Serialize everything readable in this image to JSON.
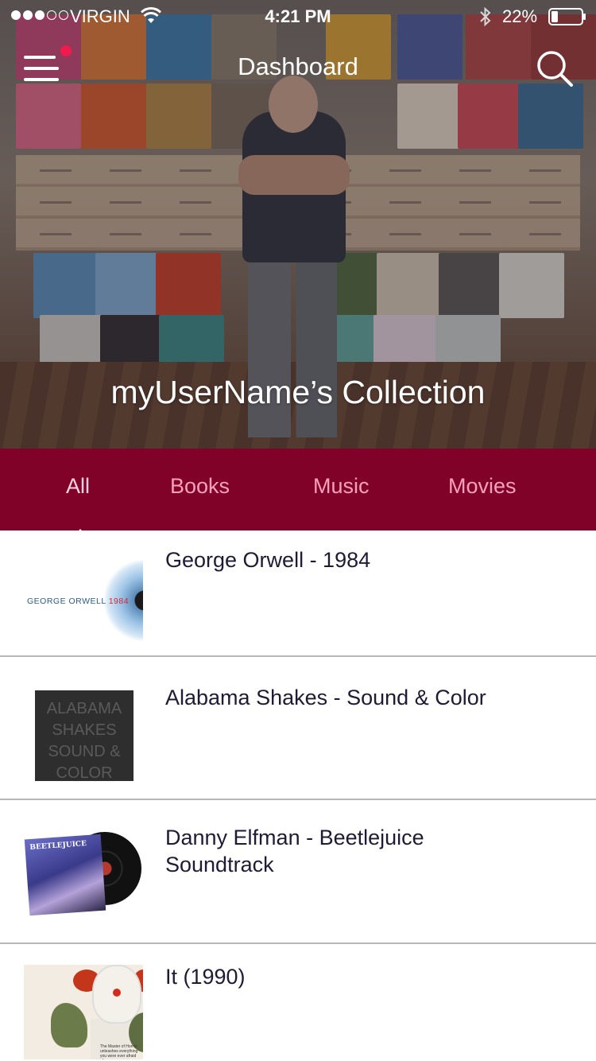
{
  "status_bar": {
    "carrier": "VIRGIN",
    "time": "4:21 PM",
    "battery": "22%",
    "signal_bars_filled": 3,
    "signal_bars_total": 5,
    "battery_level": 0.22,
    "icons": [
      "wifi-icon",
      "bluetooth-icon",
      "battery-icon"
    ]
  },
  "nav": {
    "title": "Dashboard",
    "menu_icon": "hamburger-menu-icon",
    "search_icon": "search-icon",
    "notification_badge_color": "#ef1b4e"
  },
  "hero": {
    "collection_title": "myUserName’s Collection"
  },
  "tabs": {
    "items": [
      {
        "label": "All",
        "active": true
      },
      {
        "label": "Books",
        "active": false
      },
      {
        "label": "Music",
        "active": false
      },
      {
        "label": "Movies",
        "active": false
      }
    ],
    "background_color": "#810229",
    "label_color": "#f6a0bc"
  },
  "collection": {
    "items": [
      {
        "title": "George Orwell - 1984",
        "cover": {
          "icon": "book-cover-1984",
          "text_author": "GEORGE ORWELL",
          "text_title": "1984"
        }
      },
      {
        "title": "Alabama Shakes - Sound & Color",
        "cover": {
          "icon": "album-cover-alabama-shakes",
          "lines": [
            "ALABAMA",
            "SHAKES",
            "SOUND &",
            "COLOR"
          ]
        }
      },
      {
        "title": "Danny Elfman - Beetlejuice Soundtrack",
        "cover": {
          "icon": "album-cover-beetlejuice",
          "text_title": "BEETLEJUICE"
        }
      },
      {
        "title": "It (1990)",
        "cover": {
          "icon": "movie-cover-it",
          "tagline": "The Master of Horror unleashes everything you were ever afraid of."
        }
      }
    ]
  }
}
